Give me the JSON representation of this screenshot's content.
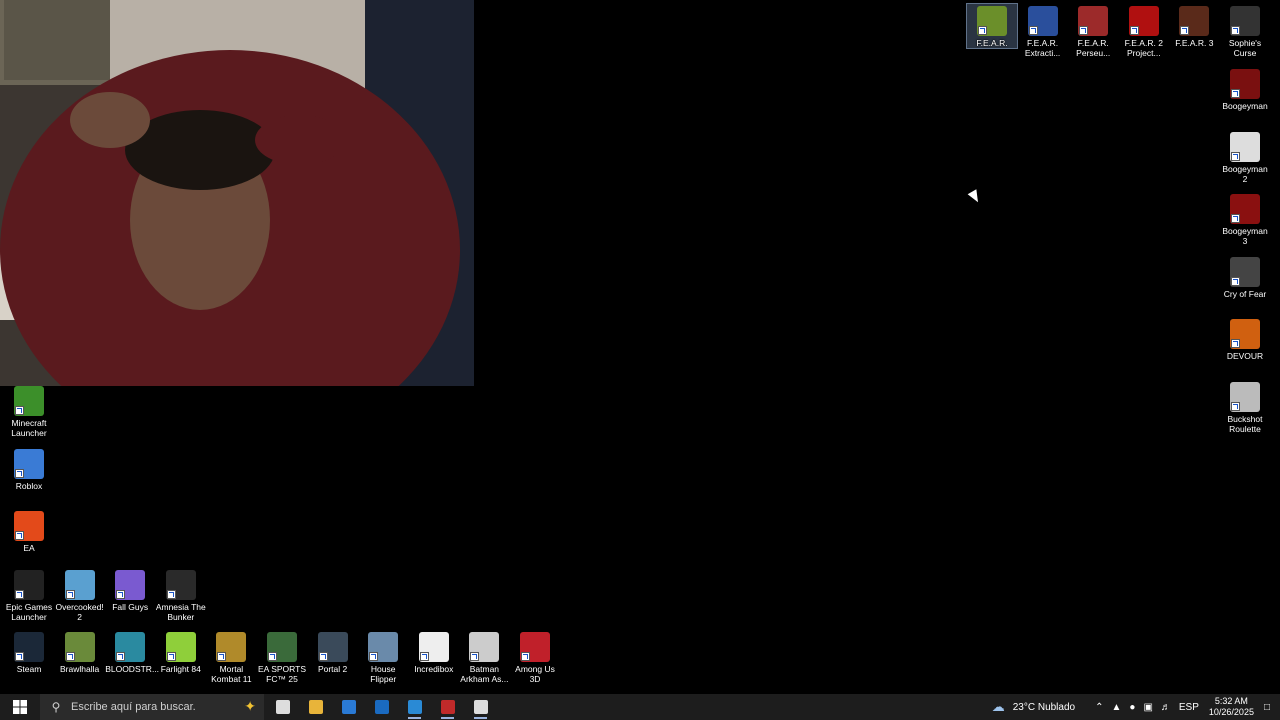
{
  "webcam": {
    "label": "webcam-overlay"
  },
  "desktop_icons_right_top": [
    {
      "name": "F.E.A.R.",
      "color": "#6b8f2a",
      "selected": true
    },
    {
      "name": "F.E.A.R. Extracti...",
      "color": "#2a4f9c"
    },
    {
      "name": "F.E.A.R. Perseu...",
      "color": "#9c2a2a"
    },
    {
      "name": "F.E.A.R. 2 Project...",
      "color": "#b01010"
    },
    {
      "name": "F.E.A.R. 3",
      "color": "#5a2a1a"
    },
    {
      "name": "Sophie's Curse",
      "color": "#333333"
    }
  ],
  "desktop_icons_right_col": [
    {
      "name": "Boogeyman",
      "color": "#7a1010"
    },
    {
      "name": "Boogeyman 2",
      "color": "#dddddd"
    },
    {
      "name": "Boogeyman 3",
      "color": "#8a1010"
    },
    {
      "name": "Cry of Fear",
      "color": "#444444"
    },
    {
      "name": "DEVOUR",
      "color": "#d06010"
    },
    {
      "name": "Buckshot Roulette",
      "color": "#bbbbbb"
    }
  ],
  "desktop_icons_left_col": [
    {
      "name": "Minecraft Launcher",
      "color": "#3c8f2a"
    },
    {
      "name": "Roblox",
      "color": "#3a7bd5"
    },
    {
      "name": "EA",
      "color": "#e34a1a"
    }
  ],
  "desktop_icons_row1": [
    {
      "name": "Epic Games Launcher",
      "color": "#222222"
    },
    {
      "name": "Overcooked! 2",
      "color": "#5aa0d0"
    },
    {
      "name": "Fall Guys",
      "color": "#7a5ad0"
    },
    {
      "name": "Amnesia The Bunker",
      "color": "#2a2a2a"
    }
  ],
  "desktop_icons_row2": [
    {
      "name": "Steam",
      "color": "#1b2838"
    },
    {
      "name": "Brawlhalla",
      "color": "#6a8a3a"
    },
    {
      "name": "BLOODSTR...",
      "color": "#2a8aa0"
    },
    {
      "name": "Farlight 84",
      "color": "#8fcf3a"
    },
    {
      "name": "Mortal Kombat 11",
      "color": "#b08a2a"
    },
    {
      "name": "EA SPORTS FC™ 25",
      "color": "#3a6a3a"
    },
    {
      "name": "Portal 2",
      "color": "#3a4a5a"
    },
    {
      "name": "House Flipper",
      "color": "#6a8aaa"
    },
    {
      "name": "Incredibox",
      "color": "#eeeeee"
    },
    {
      "name": "Batman Arkham As...",
      "color": "#cccccc"
    },
    {
      "name": "Among Us 3D",
      "color": "#c0202a"
    }
  ],
  "taskbar": {
    "search_placeholder": "Escribe aquí para buscar.",
    "apps": [
      {
        "name": "task-view",
        "color": "#dddddd"
      },
      {
        "name": "file-explorer",
        "color": "#e8b43a"
      },
      {
        "name": "microsoft-store",
        "color": "#2a7ad5"
      },
      {
        "name": "outlook",
        "color": "#1a6ac0"
      },
      {
        "name": "app-blue",
        "color": "#2a8ad5"
      },
      {
        "name": "app-red",
        "color": "#c02a2a"
      },
      {
        "name": "obs",
        "color": "#dddddd"
      }
    ],
    "weather": "23°C  Nublado",
    "lang": "ESP",
    "time": "5:32 AM",
    "date": "10/26/2025"
  }
}
